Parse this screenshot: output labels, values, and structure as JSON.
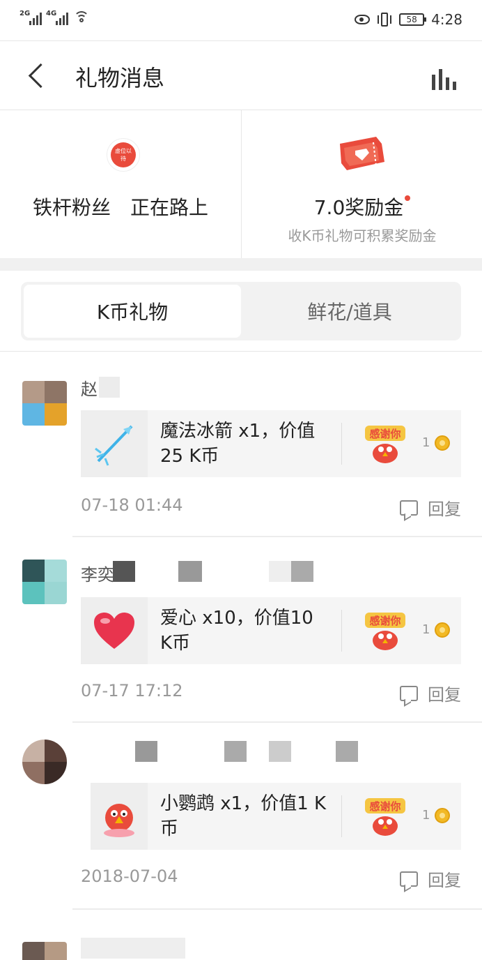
{
  "status_bar": {
    "network1": "2G",
    "network2": "4G",
    "battery": "58",
    "time": "4:28",
    "icons": [
      "signal-icon",
      "wifi-icon",
      "eye-icon",
      "vibrate-icon",
      "battery-icon"
    ]
  },
  "header": {
    "title": "礼物消息",
    "back_icon": "back-arrow-icon",
    "stats_icon": "bar-chart-icon"
  },
  "cards": {
    "fan": {
      "badge_text": "虚位以待",
      "label": "铁杆粉丝　正在路上"
    },
    "bonus": {
      "amount": "7.0奖励金",
      "subtitle": "收K币礼物可积累奖励金",
      "dot_color": "#e94b3c"
    }
  },
  "tabs": [
    {
      "label": "K币礼物",
      "active": true
    },
    {
      "label": "鲜花/道具",
      "active": false
    }
  ],
  "messages": [
    {
      "user": "赵",
      "gift_text": "魔法冰箭 x1，价值25 K币",
      "gift_icon": "ice-arrow-icon",
      "thanks_count": "1",
      "time": "07-18 01:44",
      "reply_label": "回复"
    },
    {
      "user": "李奕",
      "gift_text": "爱心 x10，价值10 K币",
      "gift_icon": "heart-icon",
      "thanks_count": "1",
      "time": "07-17 17:12",
      "reply_label": "回复"
    },
    {
      "user": "",
      "gift_text": "小鹦鹉 x1，价值1 K币",
      "gift_icon": "parrot-icon",
      "thanks_count": "1",
      "time": "2018-07-04",
      "reply_label": "回复"
    }
  ],
  "thanks_label": "感谢你",
  "colors": {
    "accent": "#e94b3c",
    "coin": "#f2b925",
    "divider": "#e6e6e6"
  }
}
